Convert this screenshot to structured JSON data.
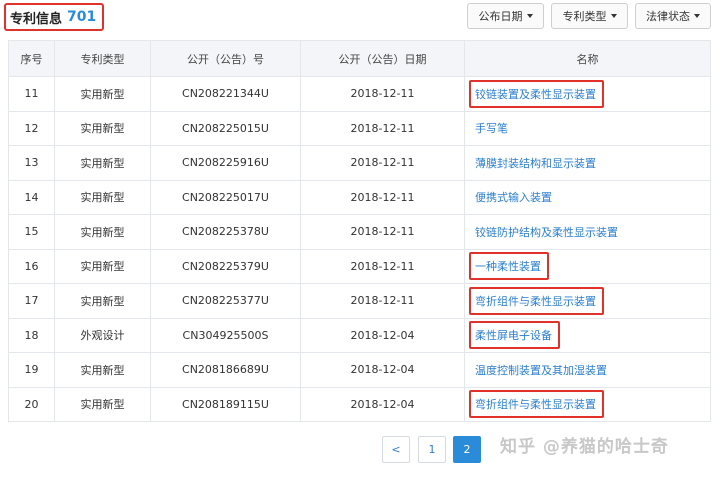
{
  "header": {
    "title": "专利信息",
    "count": "701"
  },
  "filters": [
    {
      "label": "公布日期"
    },
    {
      "label": "专利类型"
    },
    {
      "label": "法律状态"
    }
  ],
  "table": {
    "headers": [
      "序号",
      "专利类型",
      "公开（公告）号",
      "公开（公告）日期",
      "名称"
    ],
    "rows": [
      {
        "no": "11",
        "type": "实用新型",
        "pub": "CN208221344U",
        "date": "2018-12-11",
        "name": "铰链装置及柔性显示装置",
        "highlight": true
      },
      {
        "no": "12",
        "type": "实用新型",
        "pub": "CN208225015U",
        "date": "2018-12-11",
        "name": "手写笔",
        "highlight": false
      },
      {
        "no": "13",
        "type": "实用新型",
        "pub": "CN208225916U",
        "date": "2018-12-11",
        "name": "薄膜封装结构和显示装置",
        "highlight": false
      },
      {
        "no": "14",
        "type": "实用新型",
        "pub": "CN208225017U",
        "date": "2018-12-11",
        "name": "便携式输入装置",
        "highlight": false
      },
      {
        "no": "15",
        "type": "实用新型",
        "pub": "CN208225378U",
        "date": "2018-12-11",
        "name": "铰链防护结构及柔性显示装置",
        "highlight": false
      },
      {
        "no": "16",
        "type": "实用新型",
        "pub": "CN208225379U",
        "date": "2018-12-11",
        "name": "一种柔性装置",
        "highlight": true
      },
      {
        "no": "17",
        "type": "实用新型",
        "pub": "CN208225377U",
        "date": "2018-12-11",
        "name": "弯折组件与柔性显示装置",
        "highlight": true
      },
      {
        "no": "18",
        "type": "外观设计",
        "pub": "CN304925500S",
        "date": "2018-12-04",
        "name": "柔性屏电子设备",
        "highlight": true
      },
      {
        "no": "19",
        "type": "实用新型",
        "pub": "CN208186689U",
        "date": "2018-12-04",
        "name": "温度控制装置及其加湿装置",
        "highlight": false
      },
      {
        "no": "20",
        "type": "实用新型",
        "pub": "CN208189115U",
        "date": "2018-12-04",
        "name": "弯折组件与柔性显示装置",
        "highlight": true
      }
    ]
  },
  "pagination": {
    "prev": "<",
    "pages": [
      "1",
      "2"
    ],
    "active": "2"
  },
  "watermark": "知乎 @养猫的哈士奇",
  "colors": {
    "accent": "#2a8bd8",
    "highlight_border": "#e0312b",
    "link": "#2a7ecf"
  }
}
